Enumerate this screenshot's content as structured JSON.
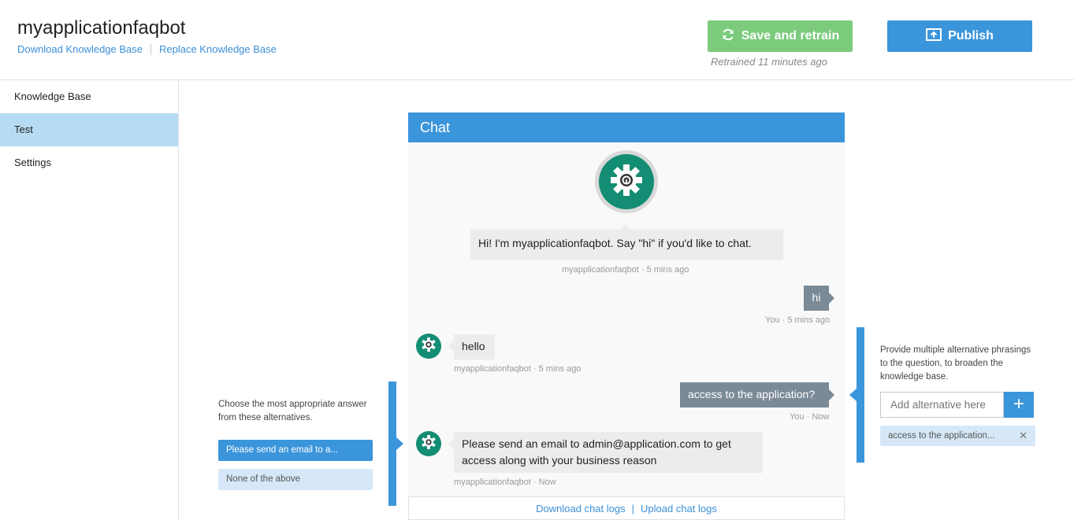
{
  "header": {
    "title": "myapplicationfaqbot",
    "links": [
      "Download Knowledge Base",
      "Replace Knowledge Base"
    ],
    "save_label": "Save and retrain",
    "publish_label": "Publish",
    "retrained": "Retrained 11 minutes ago"
  },
  "sidebar": {
    "items": [
      {
        "label": "Knowledge Base"
      },
      {
        "label": "Test"
      },
      {
        "label": "Settings"
      }
    ],
    "active": "Test"
  },
  "chat": {
    "title": "Chat",
    "messages": [
      {
        "from": "bot",
        "text": "Hi! I'm myapplicationfaqbot. Say \"hi\" if you'd like to chat.",
        "meta": "myapplicationfaqbot · 5 mins ago"
      },
      {
        "from": "user",
        "text": "hi",
        "meta": "You · 5 mins ago"
      },
      {
        "from": "bot",
        "text": "hello",
        "meta": "myapplicationfaqbot · 5 mins ago"
      },
      {
        "from": "user",
        "text": "access to the application?",
        "meta": "You · Now"
      },
      {
        "from": "bot",
        "text": "Please send an email to admin@application.com to get access along with your business reason",
        "meta": "myapplicationfaqbot · Now"
      }
    ],
    "footer": {
      "download": "Download chat logs",
      "separator": "|",
      "upload": "Upload chat logs"
    }
  },
  "answer_panel": {
    "help": "Choose the most appropriate answer from these alternatives.",
    "options": [
      "Please send an email to a...",
      "None of the above"
    ]
  },
  "alternatives_panel": {
    "help": "Provide multiple alternative phrasings to the question, to broaden the knowledge base.",
    "placeholder": "Add alternative here",
    "add_symbol": "+",
    "tags": [
      "access to the application..."
    ],
    "remove_symbol": "✕"
  },
  "colors": {
    "primary": "#3b95db",
    "save_green": "#7ccb7d",
    "bot_avatar": "#138d73",
    "user_bubble": "#7b8a97",
    "sidebar_active": "#b6dcf3"
  },
  "icons": {
    "save": "refresh-icon",
    "publish": "upload-icon",
    "bot": "gear-icon"
  }
}
